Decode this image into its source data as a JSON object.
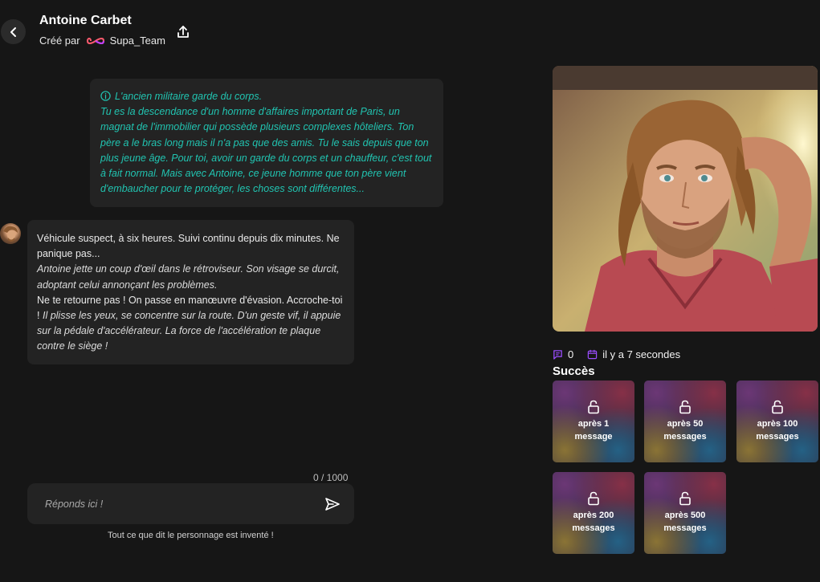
{
  "header": {
    "title": "Antoine Carbet",
    "created_by_label": "Créé par",
    "creator_name": "Supa_Team"
  },
  "intro": {
    "heading": "L'ancien militaire garde du corps.",
    "body": "Tu es la descendance d'un homme d'affaires important de Paris, un magnat de l'immobilier qui possède plusieurs complexes hôteliers. Ton père a le bras long mais il n'a pas que des amis. Tu le sais depuis que ton plus jeune âge. Pour toi, avoir un garde du corps et un chauffeur, c'est tout à fait normal. Mais avec Antoine, ce jeune homme que ton père vient d'embaucher pour te protéger, les choses sont différentes..."
  },
  "message": {
    "p1": "Véhicule suspect, à six heures. Suivi continu depuis dix minutes. Ne panique pas...",
    "p2": "Antoine jette un coup d'œil dans le rétroviseur. Son visage se durcit, adoptant celui annonçant les problèmes.",
    "p3": "Ne te retourne pas ! On passe en manœuvre d'évasion. Accroche-toi !",
    "p4": "Il plisse les yeux, se concentre sur la route. D'un geste vif, il appuie sur la pédale d'accélérateur. La force de l'accélération te plaque contre le siège !"
  },
  "composer": {
    "counter": "0 / 1000",
    "placeholder": "Réponds ici !",
    "disclaimer": "Tout ce que dit le personnage est inventé !"
  },
  "stats": {
    "messages_count": "0",
    "created_ago": "il y a 7 secondes"
  },
  "achievements": {
    "title": "Succès",
    "items": [
      {
        "label": "après 1 message"
      },
      {
        "label": "après 50 messages"
      },
      {
        "label": "après 100 messages"
      },
      {
        "label": "après 200 messages"
      },
      {
        "label": "après 500 messages"
      }
    ]
  },
  "colors": {
    "background": "#161616",
    "bubble": "#232323",
    "intro_text": "#21c4b1",
    "accent_purple": "#9b4dff"
  }
}
